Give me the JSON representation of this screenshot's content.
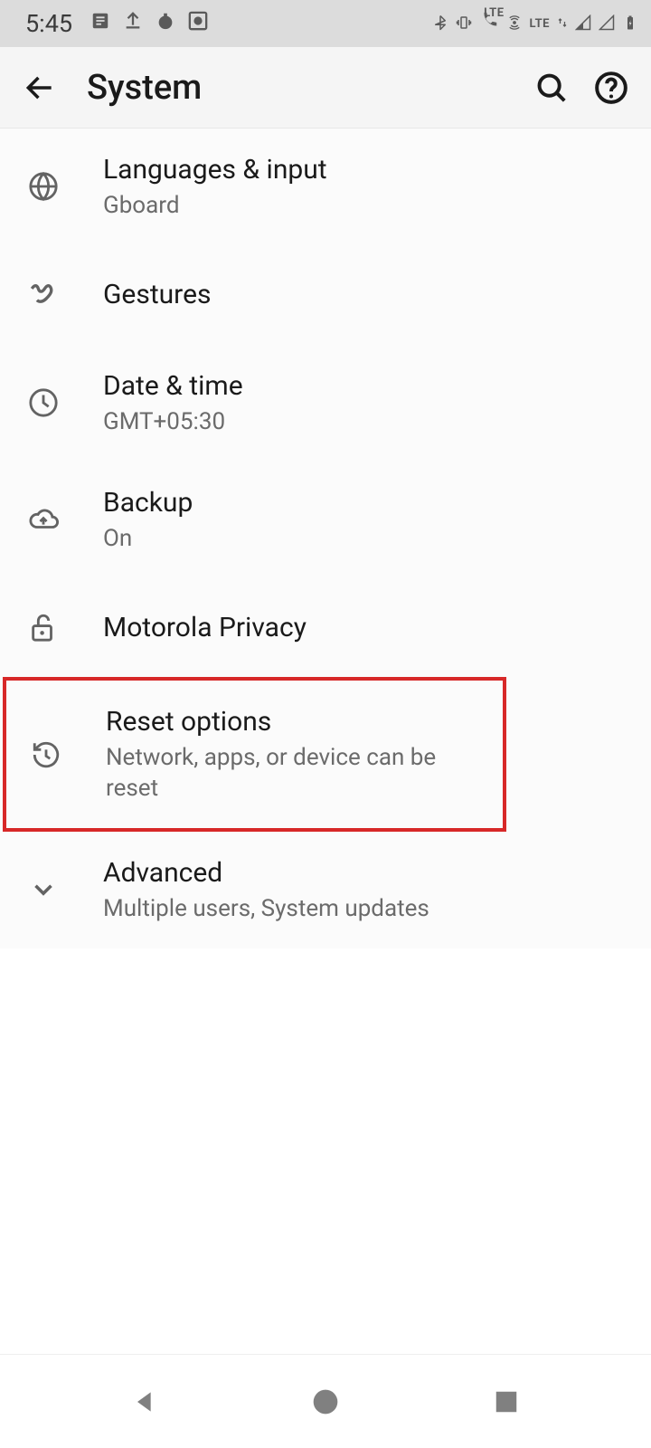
{
  "status": {
    "time": "5:45",
    "lte1": "LTE",
    "lte2": "LTE"
  },
  "header": {
    "title": "System"
  },
  "items": [
    {
      "title": "Languages & input",
      "subtitle": "Gboard"
    },
    {
      "title": "Gestures",
      "subtitle": ""
    },
    {
      "title": "Date & time",
      "subtitle": "GMT+05:30"
    },
    {
      "title": "Backup",
      "subtitle": "On"
    },
    {
      "title": "Motorola Privacy",
      "subtitle": ""
    },
    {
      "title": "Reset options",
      "subtitle": "Network, apps, or device can be reset"
    },
    {
      "title": "Advanced",
      "subtitle": "Multiple users, System updates"
    }
  ]
}
